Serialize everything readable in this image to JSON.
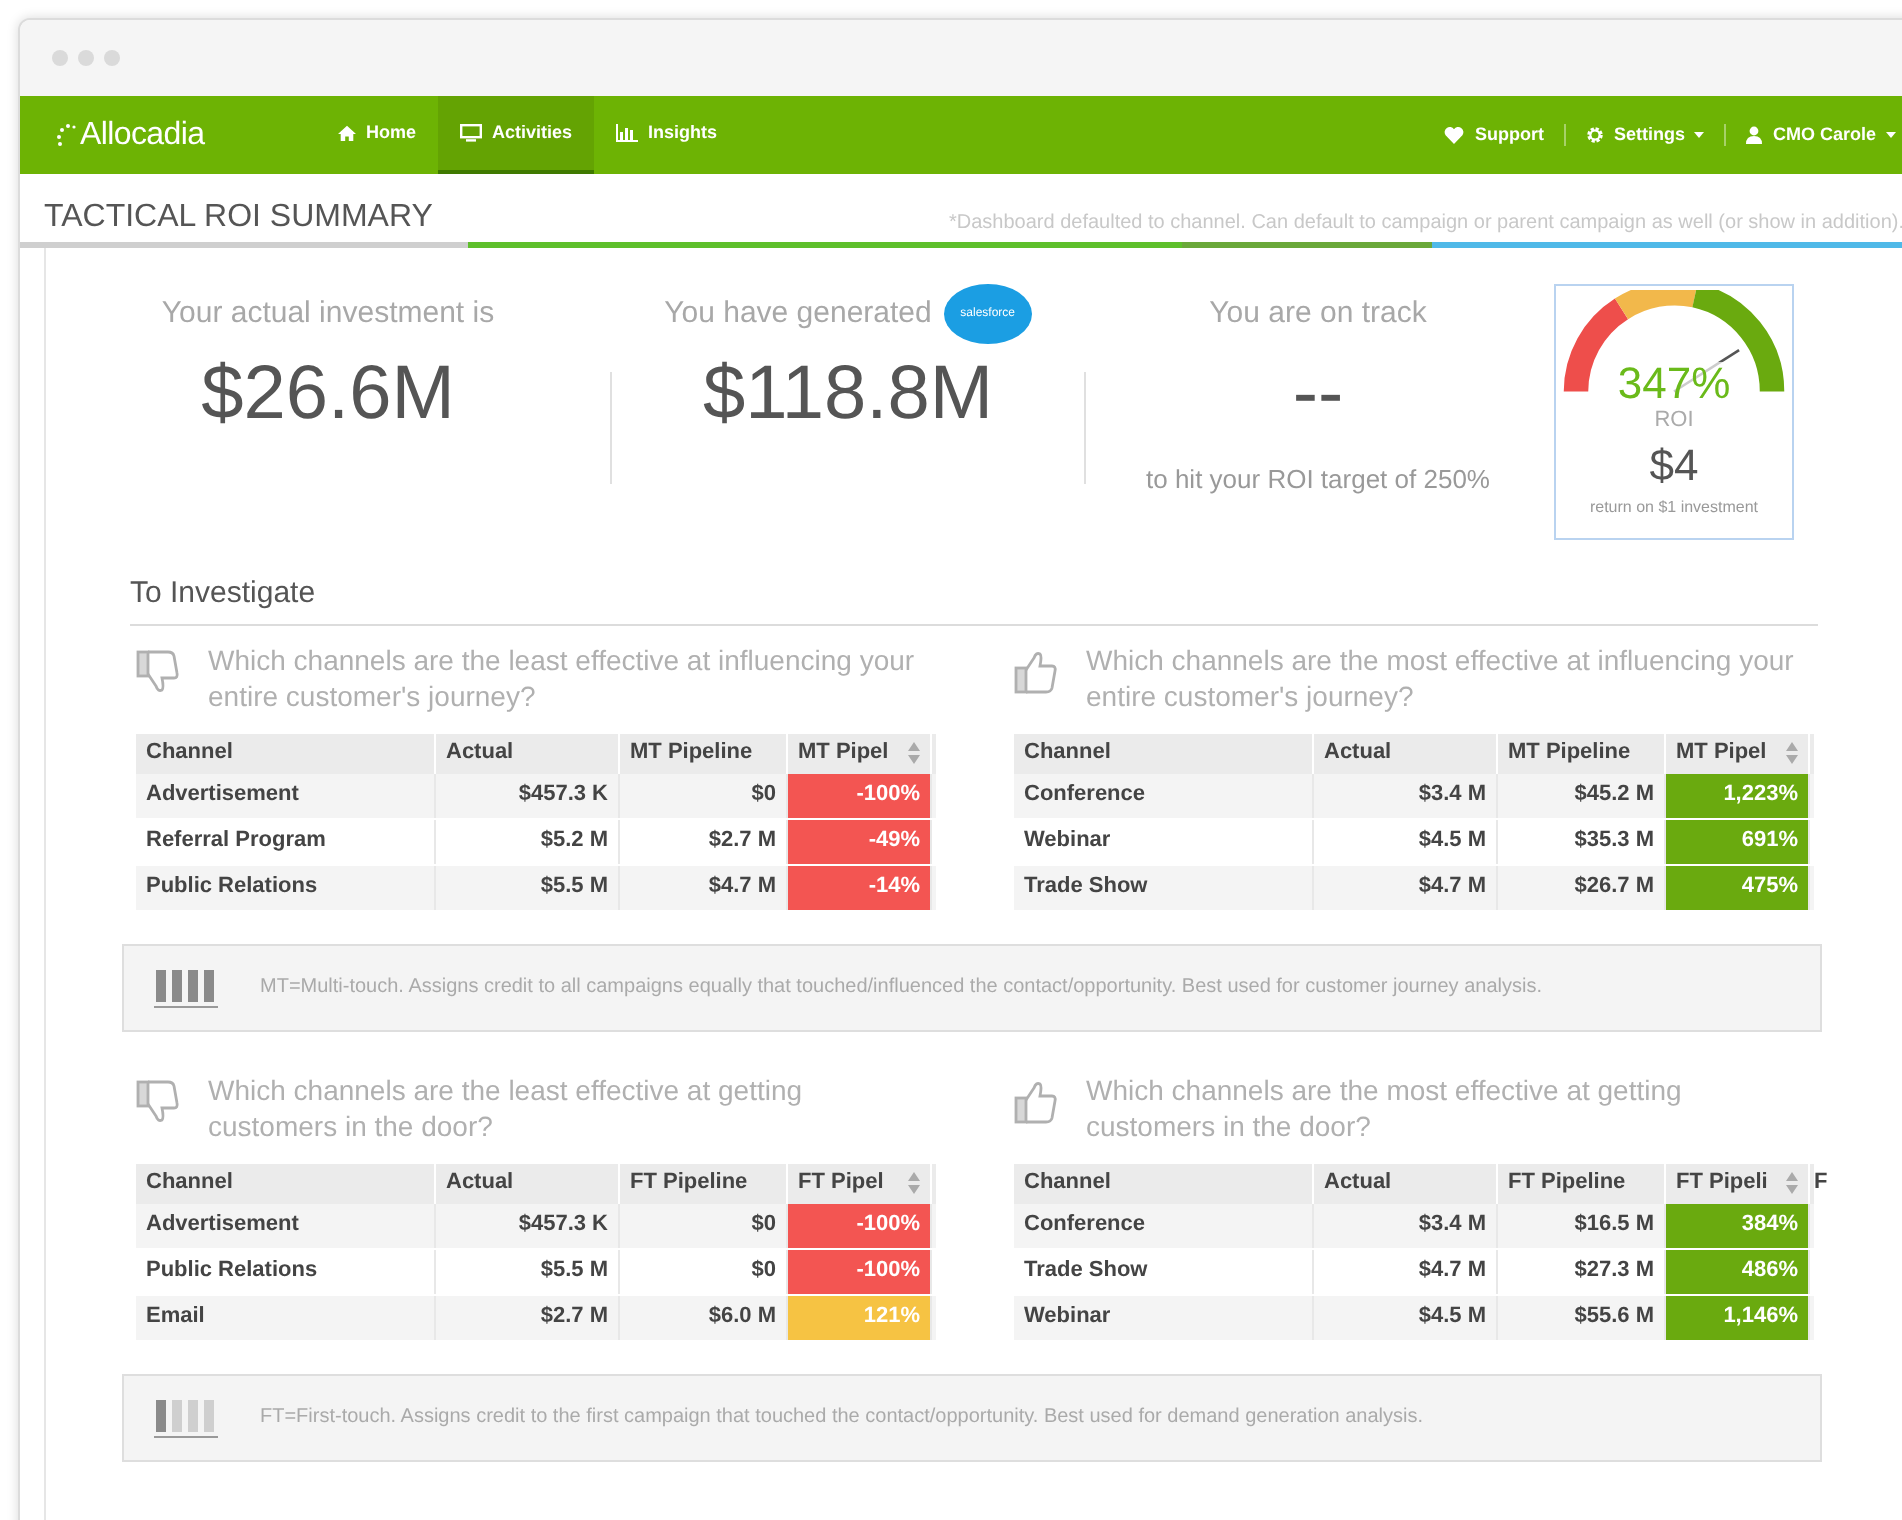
{
  "nav": {
    "brand": "Allocadia",
    "items": [
      {
        "label": "Home",
        "selected": false
      },
      {
        "label": "Activities",
        "selected": true
      },
      {
        "label": "Insights",
        "selected": false
      }
    ],
    "right": [
      {
        "label": "Support",
        "dropdown": false
      },
      {
        "label": "Settings",
        "dropdown": true
      },
      {
        "label": "CMO Carole",
        "dropdown": true
      }
    ]
  },
  "page": {
    "title": "TACTICAL ROI SUMMARY",
    "note": "*Dashboard defaulted to channel. Can default to campaign or parent campaign as well (or show in addition)."
  },
  "summary": {
    "investment": {
      "label": "Your actual investment is",
      "value": "$26.6M"
    },
    "generated": {
      "label": "You have generated",
      "badge": "salesforce",
      "value": "$118.8M"
    },
    "track": {
      "label": "You are on track",
      "value": "--",
      "caption": "to hit your ROI target of 250%"
    },
    "gauge": {
      "percent": "347%",
      "label": "ROI",
      "amount": "$4",
      "caption": "return on $1 investment"
    }
  },
  "section_title": "To Investigate",
  "quadrants": [
    {
      "kind": "least",
      "question": "Which channels are the least effective at influencing your entire customer's journey?",
      "columns": [
        "Channel",
        "Actual",
        "MT Pipeline",
        "MT Pipel"
      ],
      "rows": [
        {
          "cells": [
            "Advertisement",
            "$457.3 K",
            "$0",
            "-100%"
          ],
          "color": "#f35552"
        },
        {
          "cells": [
            "Referral Program",
            "$5.2 M",
            "$2.7 M",
            "-49%"
          ],
          "color": "#f35552"
        },
        {
          "cells": [
            "Public Relations",
            "$5.5 M",
            "$4.7 M",
            "-14%"
          ],
          "color": "#f35552"
        }
      ]
    },
    {
      "kind": "most",
      "question": "Which channels are the most effective at influencing your entire customer's journey?",
      "columns": [
        "Channel",
        "Actual",
        "MT Pipeline",
        "MT Pipel"
      ],
      "rows": [
        {
          "cells": [
            "Conference",
            "$3.4 M",
            "$45.2 M",
            "1,223%"
          ],
          "color": "#6aaa0f"
        },
        {
          "cells": [
            "Webinar",
            "$4.5 M",
            "$35.3 M",
            "691%"
          ],
          "color": "#6aaa0f"
        },
        {
          "cells": [
            "Trade Show",
            "$4.7 M",
            "$26.7 M",
            "475%"
          ],
          "color": "#6aaa0f"
        }
      ]
    },
    {
      "kind": "legend",
      "text": "MT=Multi-touch. Assigns credit to all campaigns equally that touched/influenced the contact/opportunity. Best used for customer journey analysis."
    },
    {
      "kind": "least",
      "question": "Which channels are the least effective at getting customers in the door?",
      "columns": [
        "Channel",
        "Actual",
        "FT Pipeline",
        "FT Pipel"
      ],
      "rows": [
        {
          "cells": [
            "Advertisement",
            "$457.3 K",
            "$0",
            "-100%"
          ],
          "color": "#f35552"
        },
        {
          "cells": [
            "Public Relations",
            "$5.5 M",
            "$0",
            "-100%"
          ],
          "color": "#f35552"
        },
        {
          "cells": [
            "Email",
            "$2.7 M",
            "$6.0 M",
            "121%"
          ],
          "color": "#f6c343"
        }
      ]
    },
    {
      "kind": "most",
      "question": "Which channels are the most effective at getting customers in the door?",
      "columns": [
        "Channel",
        "Actual",
        "FT Pipeline",
        "FT Pipeli",
        "F"
      ],
      "rows": [
        {
          "cells": [
            "Conference",
            "$3.4 M",
            "$16.5 M",
            "384%"
          ],
          "color": "#6aaa0f"
        },
        {
          "cells": [
            "Trade Show",
            "$4.7 M",
            "$27.3 M",
            "486%"
          ],
          "color": "#6aaa0f"
        },
        {
          "cells": [
            "Webinar",
            "$4.5 M",
            "$55.6 M",
            "1,146%"
          ],
          "color": "#6aaa0f"
        }
      ]
    },
    {
      "kind": "legend",
      "text": "FT=First-touch. Assigns credit to the first campaign that touched the contact/opportunity. Best used for demand generation analysis."
    }
  ]
}
